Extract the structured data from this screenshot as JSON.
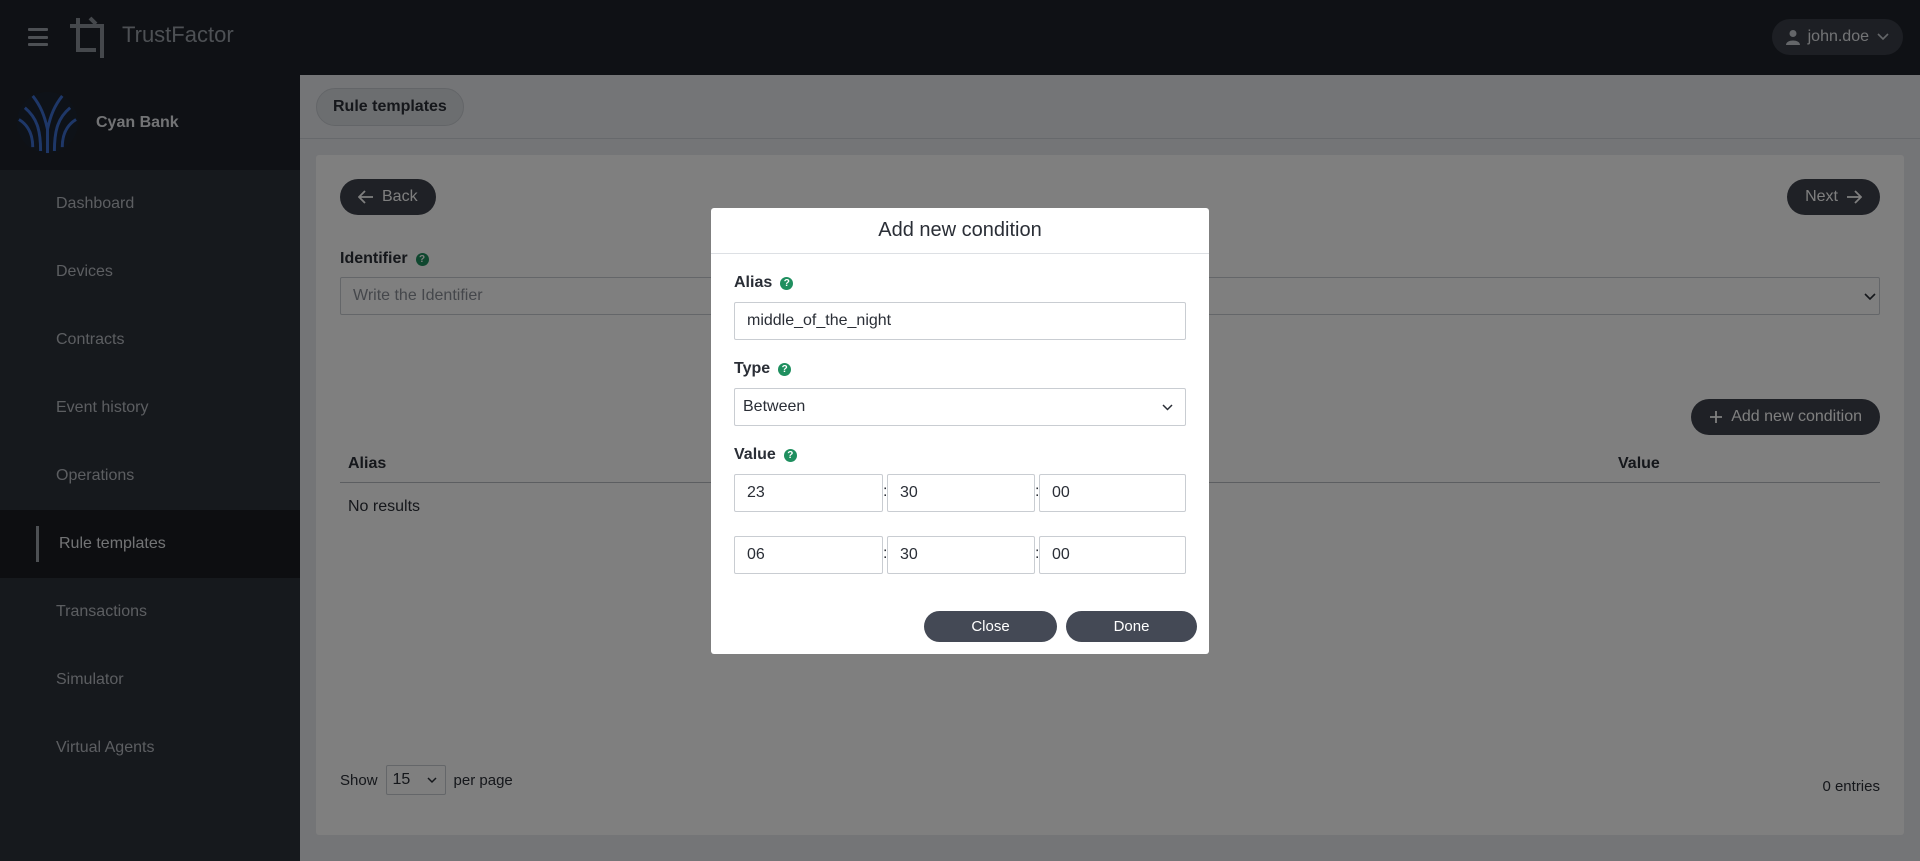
{
  "app": {
    "brand_name": "TrustFactor",
    "user_name": "john.doe"
  },
  "org": {
    "name": "Cyan Bank"
  },
  "sidebar": {
    "items": [
      {
        "label": "Dashboard"
      },
      {
        "label": "Devices"
      },
      {
        "label": "Contracts"
      },
      {
        "label": "Event history"
      },
      {
        "label": "Operations"
      },
      {
        "label": "Rule templates",
        "active": true
      },
      {
        "label": "Transactions"
      },
      {
        "label": "Simulator"
      },
      {
        "label": "Virtual Agents"
      }
    ]
  },
  "breadcrumb": {
    "label": "Rule templates"
  },
  "page": {
    "back_label": "Back",
    "next_label": "Next",
    "identifier_label": "Identifier",
    "identifier_placeholder": "Write the Identifier",
    "add_condition_label": "Add new condition",
    "table": {
      "columns": [
        "Alias",
        "Value"
      ],
      "empty_text": "No results"
    },
    "pager": {
      "show_label": "Show",
      "per_page_value": "15",
      "per_page_label": "per page",
      "entries_text": "0 entries"
    }
  },
  "modal": {
    "title": "Add new condition",
    "alias_label": "Alias",
    "alias_value": "middle_of_the_night",
    "type_label": "Type",
    "type_value": "Between",
    "value_label": "Value",
    "start": {
      "h": "23",
      "m": "30",
      "s": "00"
    },
    "end": {
      "h": "06",
      "m": "30",
      "s": "00"
    },
    "close_label": "Close",
    "done_label": "Done"
  },
  "colors": {
    "topbar": "#1f232b",
    "sidebar": "#2d323b",
    "button": "#3e434d",
    "help": "#1f8f5f"
  }
}
